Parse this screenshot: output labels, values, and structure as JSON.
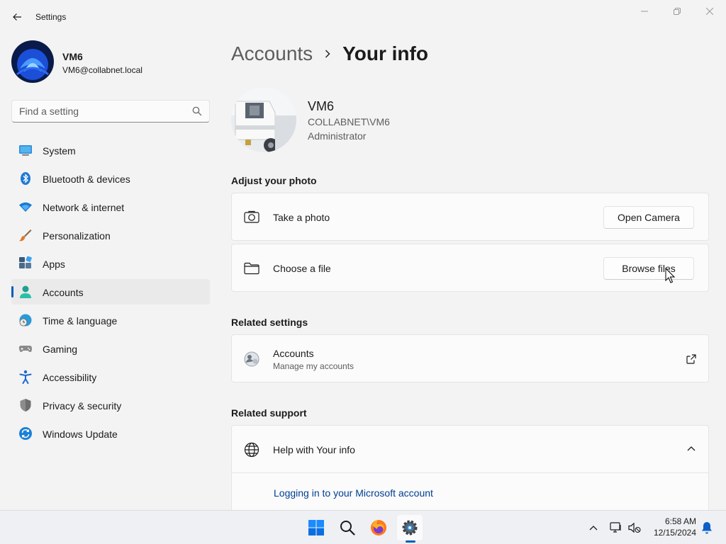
{
  "window": {
    "title": "Settings"
  },
  "profile": {
    "name": "VM6",
    "email": "VM6@collabnet.local"
  },
  "search": {
    "placeholder": "Find a setting"
  },
  "sidebar": {
    "items": [
      {
        "label": "System",
        "icon": "system-icon"
      },
      {
        "label": "Bluetooth & devices",
        "icon": "bluetooth-icon"
      },
      {
        "label": "Network & internet",
        "icon": "network-icon"
      },
      {
        "label": "Personalization",
        "icon": "paintbrush-icon"
      },
      {
        "label": "Apps",
        "icon": "apps-icon"
      },
      {
        "label": "Accounts",
        "icon": "accounts-icon",
        "active": true
      },
      {
        "label": "Time & language",
        "icon": "clock-globe-icon"
      },
      {
        "label": "Gaming",
        "icon": "gamepad-icon"
      },
      {
        "label": "Accessibility",
        "icon": "accessibility-icon"
      },
      {
        "label": "Privacy & security",
        "icon": "shield-icon"
      },
      {
        "label": "Windows Update",
        "icon": "update-icon"
      }
    ]
  },
  "breadcrumb": {
    "parent": "Accounts",
    "current": "Your info"
  },
  "user": {
    "name": "VM6",
    "domain": "COLLABNET\\VM6",
    "role": "Administrator"
  },
  "adjust_photo": {
    "title": "Adjust your photo",
    "take_photo": {
      "label": "Take a photo",
      "button": "Open Camera"
    },
    "choose_file": {
      "label": "Choose a file",
      "button": "Browse files"
    }
  },
  "related_settings": {
    "title": "Related settings",
    "accounts": {
      "label": "Accounts",
      "sub": "Manage my accounts"
    }
  },
  "related_support": {
    "title": "Related support",
    "help": {
      "label": "Help with Your info"
    },
    "link": "Logging in to your Microsoft account"
  },
  "taskbar": {
    "time": "6:58 AM",
    "date": "12/15/2024"
  },
  "colors": {
    "accent": "#005fb8",
    "link": "#003e92"
  }
}
